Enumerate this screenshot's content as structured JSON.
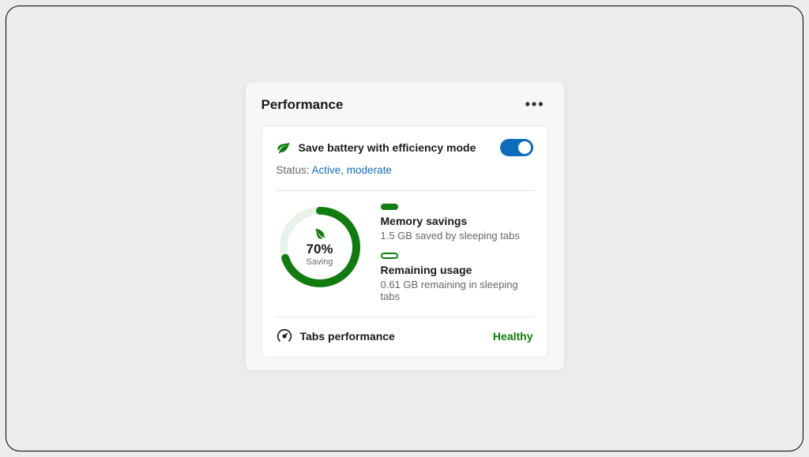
{
  "card": {
    "title": "Performance",
    "more_label": "•••"
  },
  "efficiency": {
    "label": "Save battery with efficiency mode",
    "toggle_on": true,
    "status_prefix": "Status: ",
    "status_value": "Active, moderate"
  },
  "gauge": {
    "percent": 70,
    "percent_label": "70%",
    "caption": "Saving"
  },
  "memory_savings": {
    "title": "Memory savings",
    "desc": "1.5 GB saved by sleeping tabs"
  },
  "remaining_usage": {
    "title": "Remaining usage",
    "desc": "0.61 GB remaining in sleeping tabs"
  },
  "tabs_perf": {
    "label": "Tabs performance",
    "status": "Healthy"
  },
  "colors": {
    "accent_green": "#107c10",
    "accent_blue": "#0f6cbd"
  }
}
